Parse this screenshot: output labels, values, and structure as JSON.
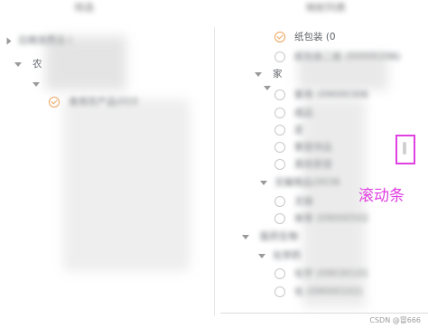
{
  "left_panel": {
    "header": "待选",
    "rows": [
      {
        "label": "日用消费品 ( ",
        "checked": null
      },
      {
        "label": "农 ",
        "checked": null
      },
      {
        "label": "食用农产品(010",
        "checked": true
      }
    ]
  },
  "right_panel": {
    "header": "映射列表",
    "rows": [
      {
        "label": "纸包装 (0",
        "checked": true
      },
      {
        "label": "纸包装二级 (00000206)",
        "checked": false
      },
      {
        "label": "家 ",
        "checked": null
      },
      {
        "label": "家用  (09000306",
        "checked": false
      },
      {
        "label": "成品 ",
        "checked": false
      },
      {
        "label": "定 ",
        "checked": false
      },
      {
        "label": "家居饰品 ",
        "checked": false
      },
      {
        "label": "其他家居 ",
        "checked": false
      },
      {
        "label": "文娱用品(0036",
        "checked": null
      },
      {
        "label": "文娱 ",
        "checked": false
      },
      {
        "label": "体育 (09000502",
        "checked": false
      },
      {
        "label": "医药生物 ",
        "checked": null
      },
      {
        "label": "化学药 ",
        "checked": null
      },
      {
        "label": "化学 (09030101",
        "checked": false
      },
      {
        "label": "化 (09000102)",
        "checked": false
      }
    ]
  },
  "annotation": {
    "label": "滚动条",
    "color": "#e040e0"
  },
  "watermark": "CSDN @冒666"
}
